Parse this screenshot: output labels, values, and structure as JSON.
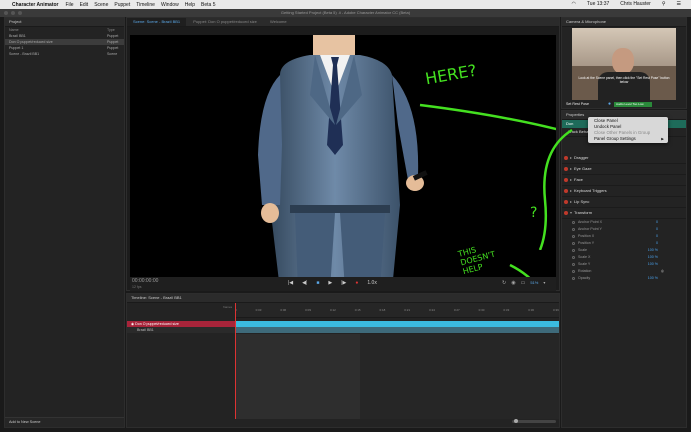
{
  "menubar": {
    "apple": "",
    "app_name": "Character Animator",
    "items": [
      "File",
      "Edit",
      "Scene",
      "Puppet",
      "Timeline",
      "Window",
      "Help",
      "Beta 5"
    ],
    "clock": "Tue 13:37",
    "user": "Chris Hauster"
  },
  "window": {
    "title": "Getting Started Project (Beta 5) .ii - Adobe Character Animator CC (Beta)"
  },
  "project_panel": {
    "title": "Project",
    "col_name": "Name",
    "col_type": "Type",
    "items": [
      {
        "name": "Brazil BB1",
        "type": "Puppet"
      },
      {
        "name": "Don O puppet/reduced size",
        "type": "Puppet"
      },
      {
        "name": "Puppet 1",
        "type": "Puppet"
      },
      {
        "name": "Scene - Brazil BB1",
        "type": "Scene"
      }
    ],
    "add_button": "Add to New Scene"
  },
  "tabs": [
    {
      "label": "Scene: Scene - Brazil BB1",
      "active": true
    },
    {
      "label": "Puppet: Don O puppet/reduced size",
      "active": false
    },
    {
      "label": "Welcome",
      "active": false
    }
  ],
  "annotations": {
    "here": "HERE?",
    "question": "?",
    "note_line1": "THIS",
    "note_line2": "DOESN'T",
    "note_line3": "HELP"
  },
  "transport": {
    "timecode": "00:00:00:00",
    "fps": "12 fps",
    "zoom": "51%",
    "speed": "1.0x"
  },
  "timeline": {
    "title": "Timeline: Scene - Brazil BB1",
    "frames_label": "frames",
    "ticks": [
      "0",
      "0:03",
      "0:06",
      "0:09",
      "0:12",
      "0:15",
      "0:18",
      "0:21",
      "0:24",
      "0:27",
      "0:30",
      "0:33",
      "0:36",
      "0:39"
    ],
    "tracks": [
      {
        "name": "Don O puppet/reduced size",
        "selected": true
      },
      {
        "name": "Brazil BB1",
        "selected": false
      }
    ]
  },
  "camera_panel": {
    "title": "Camera & Microphone",
    "instruction": "Look at the Scene panel, then click the \"Set Rest Pose\" button below",
    "set_rest_pose": "Set Rest Pose",
    "audio_label": "Audio Level Too Low"
  },
  "properties_panel": {
    "title": "Properties",
    "tab_label": "Don",
    "track_label": "Track Behaviors",
    "behaviors": [
      "Dragger",
      "Eye Gaze",
      "Face",
      "Keyboard Triggers",
      "Lip Sync",
      "Transform"
    ],
    "transform_props": [
      {
        "name": "Anchor Point X",
        "value": "0"
      },
      {
        "name": "Anchor Point Y",
        "value": "0"
      },
      {
        "name": "Position X",
        "value": "0"
      },
      {
        "name": "Position Y",
        "value": "0"
      },
      {
        "name": "Scale",
        "value": "100 %"
      },
      {
        "name": "Scale X",
        "value": "100 %"
      },
      {
        "name": "Scale Y",
        "value": "100 %"
      },
      {
        "name": "Rotation",
        "value": "0"
      },
      {
        "name": "Opacity",
        "value": "100 %"
      }
    ]
  },
  "context_menu": {
    "items": [
      {
        "label": "Close Panel",
        "disabled": false
      },
      {
        "label": "Undock Panel",
        "disabled": false
      },
      {
        "label": "Close Other Panels in Group",
        "disabled": true
      },
      {
        "label": "Panel Group Settings",
        "disabled": false,
        "submenu": true
      }
    ],
    "submenu_arrow": "▶"
  },
  "colors": {
    "accent": "#5ba8e8",
    "annotation": "#44e020",
    "track_red": "#a8243a",
    "track_blue": "#3bbbe0"
  }
}
